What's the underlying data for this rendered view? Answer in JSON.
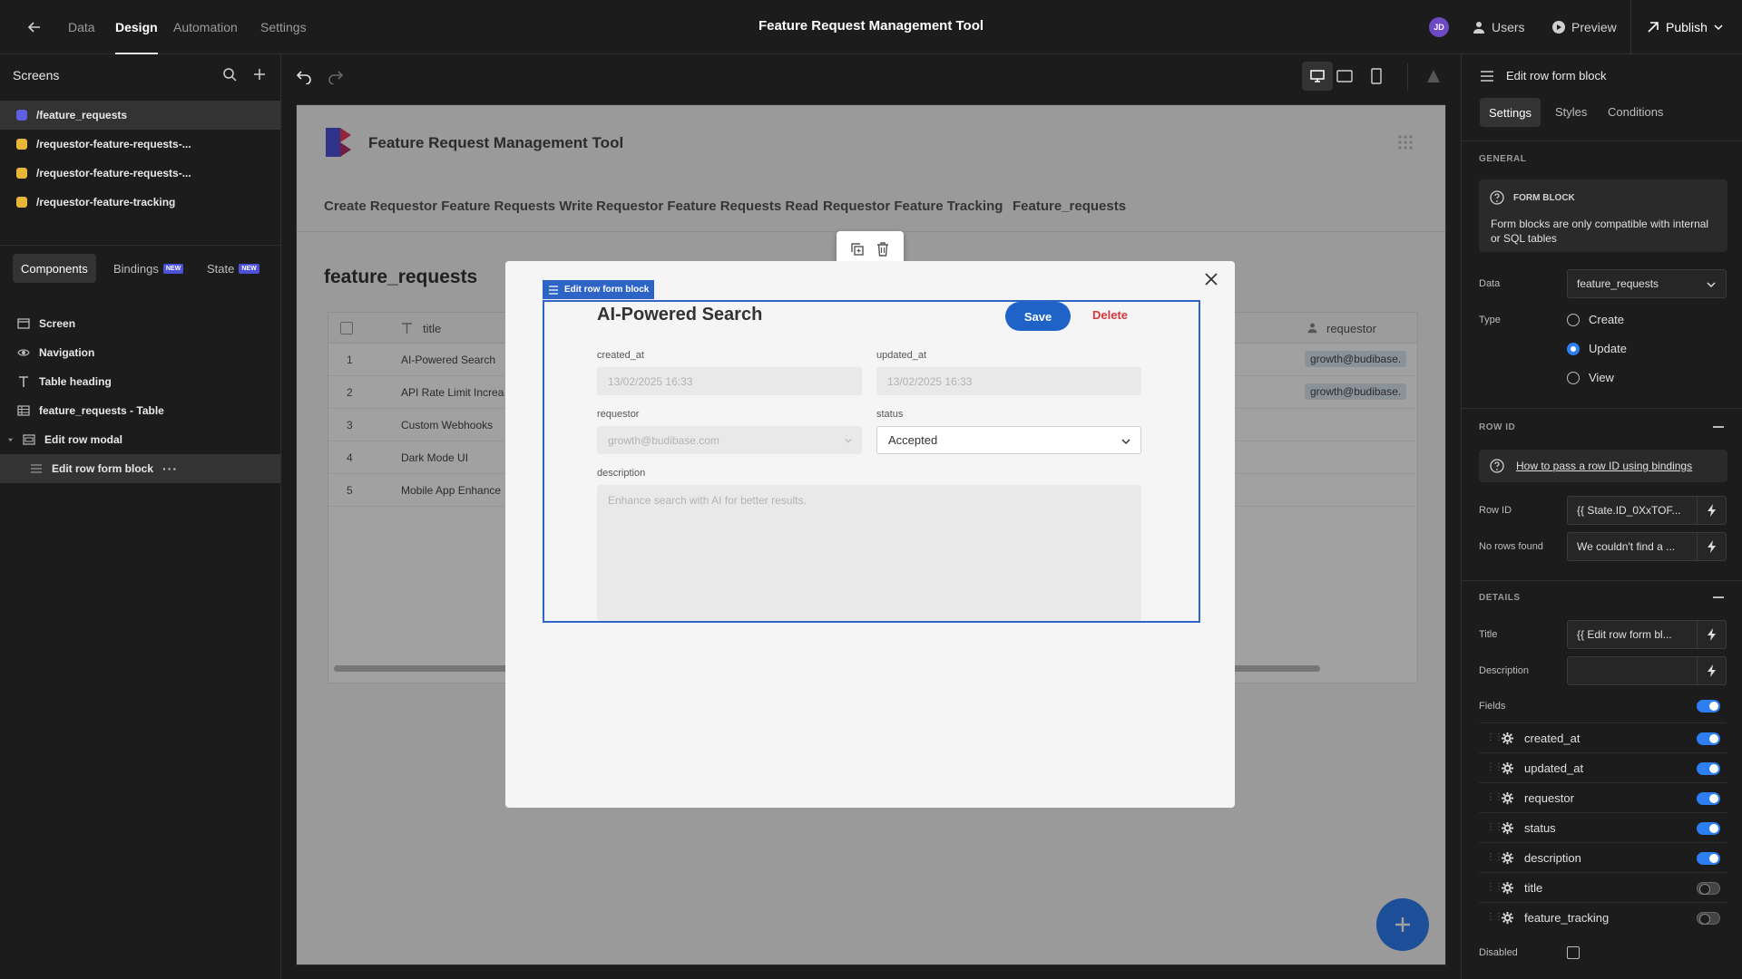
{
  "topbar": {
    "nav": [
      "Data",
      "Design",
      "Automation",
      "Settings"
    ],
    "active_nav": "Design",
    "title": "Feature Request Management Tool",
    "avatar_initials": "JD",
    "users_label": "Users",
    "preview_label": "Preview",
    "publish_label": "Publish"
  },
  "left": {
    "screens_heading": "Screens",
    "screens": [
      {
        "label": "/feature_requests",
        "color": "#5f5fe0",
        "active": true
      },
      {
        "label": "/requestor-feature-requests-...",
        "color": "#e8b73a",
        "active": false
      },
      {
        "label": "/requestor-feature-requests-...",
        "color": "#e8b73a",
        "active": false
      },
      {
        "label": "/requestor-feature-tracking",
        "color": "#e8b73a",
        "active": false
      }
    ],
    "tabs": {
      "components": "Components",
      "bindings": "Bindings",
      "state": "State",
      "new_badge": "NEW"
    },
    "tree": [
      {
        "label": "Screen",
        "icon": "screen-icon"
      },
      {
        "label": "Navigation",
        "icon": "eye-icon"
      },
      {
        "label": "Table heading",
        "icon": "text-icon"
      },
      {
        "label": "feature_requests - Table",
        "icon": "table-icon"
      },
      {
        "label": "Edit row modal",
        "icon": "modal-icon"
      },
      {
        "label": "Edit row form block",
        "icon": "form-icon",
        "active": true
      }
    ]
  },
  "preview": {
    "app_title": "Feature Request Management Tool",
    "nav": [
      "Create Requestor Feature Requests Write",
      "Requestor Feature Requests Read",
      "Requestor Feature Tracking",
      "Feature_requests"
    ],
    "table_heading": "feature_requests",
    "columns": {
      "title": "title",
      "requestor": "requestor"
    },
    "rows": [
      {
        "n": "1",
        "title": "AI-Powered Search",
        "requestor": "growth@budibase."
      },
      {
        "n": "2",
        "title": "API Rate Limit Increa",
        "requestor": "growth@budibase."
      },
      {
        "n": "3",
        "title": "Custom Webhooks",
        "requestor": ""
      },
      {
        "n": "4",
        "title": "Dark Mode UI",
        "requestor": ""
      },
      {
        "n": "5",
        "title": "Mobile App Enhance",
        "requestor": ""
      }
    ]
  },
  "modal": {
    "tag_label": "Edit row form block",
    "title": "AI-Powered Search",
    "save_label": "Save",
    "delete_label": "Delete",
    "fields": {
      "created_at_label": "created_at",
      "created_at_value": "13/02/2025 16:33",
      "updated_at_label": "updated_at",
      "updated_at_value": "13/02/2025 16:33",
      "requestor_label": "requestor",
      "requestor_value": "growth@budibase.com",
      "status_label": "status",
      "status_value": "Accepted",
      "description_label": "description",
      "description_value": "Enhance search with AI for better results."
    }
  },
  "right": {
    "header": "Edit row form block",
    "tabs": [
      "Settings",
      "Styles",
      "Conditions"
    ],
    "general": "GENERAL",
    "info_title": "FORM BLOCK",
    "info_text": "Form blocks are only compatible with internal or SQL tables",
    "data_label": "Data",
    "data_value": "feature_requests",
    "type_label": "Type",
    "type_options": [
      "Create",
      "Update",
      "View"
    ],
    "type_selected": "Update",
    "row_id_section": "ROW ID",
    "row_id_help": "How to pass a row ID using bindings",
    "row_id_label": "Row ID",
    "row_id_value": "{{ State.ID_0XxTOF...",
    "no_rows_label": "No rows found",
    "no_rows_value": "We couldn't find a ...",
    "details_section": "DETAILS",
    "title_label": "Title",
    "title_value": "{{ Edit row form bl...",
    "description_label": "Description",
    "description_value": "",
    "fields_label": "Fields",
    "fields": [
      {
        "name": "created_at",
        "on": true
      },
      {
        "name": "updated_at",
        "on": true
      },
      {
        "name": "requestor",
        "on": true
      },
      {
        "name": "status",
        "on": true
      },
      {
        "name": "description",
        "on": true
      },
      {
        "name": "title",
        "on": false
      },
      {
        "name": "feature_tracking",
        "on": false
      }
    ],
    "disabled_label": "Disabled"
  },
  "colors": {
    "accent": "#2d7ef0",
    "selection": "#2f64c7",
    "save_button": "#1f63c8",
    "delete": "#d7373f"
  }
}
